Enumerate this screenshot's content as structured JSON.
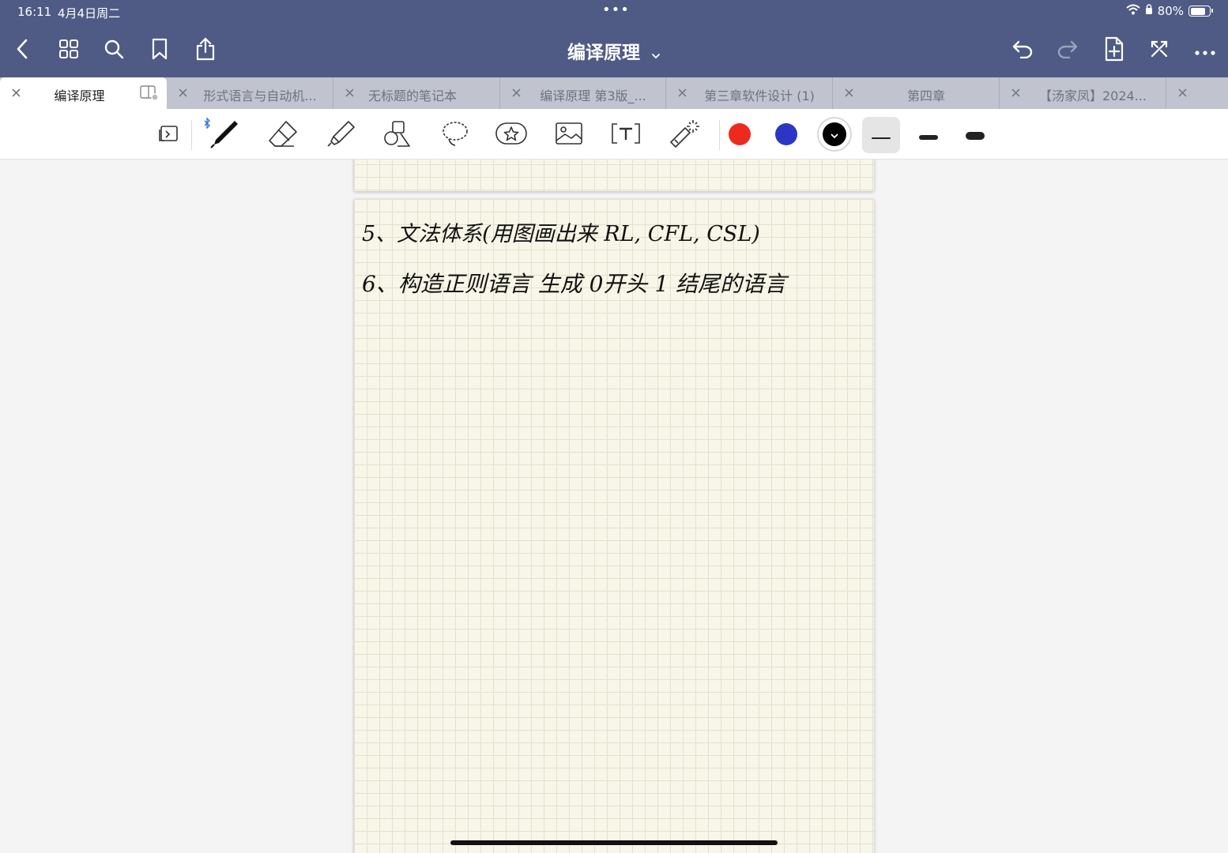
{
  "status_bar": {
    "time": "16:11",
    "date": "4月4日周二",
    "dots": "•••",
    "battery_text": "80%",
    "battery_level": 0.8
  },
  "nav": {
    "title": "编译原理",
    "left_icons": [
      "back-icon",
      "grid-icon",
      "search-icon",
      "bookmark-icon",
      "share-icon"
    ],
    "right_icons": [
      "undo-icon",
      "redo-icon",
      "add-page-icon",
      "close-fullscreen-icon",
      "more-icon"
    ]
  },
  "tabs": [
    {
      "label": "编译原理",
      "active": true
    },
    {
      "label": "形式语言与自动机...",
      "active": false
    },
    {
      "label": "无标题的笔记本",
      "active": false
    },
    {
      "label": "编译原理  第3版_...",
      "active": false
    },
    {
      "label": "第三章软件设计 (1)",
      "active": false
    },
    {
      "label": "第四章",
      "active": false
    },
    {
      "label": "【汤家凤】2024...",
      "active": false
    },
    {
      "label": "",
      "active": false
    }
  ],
  "toolbar": {
    "tools": [
      "sidebar-toggle-icon",
      "pen-icon",
      "eraser-icon",
      "highlighter-icon",
      "shapes-icon",
      "lasso-icon",
      "sticker-icon",
      "image-icon",
      "text-icon",
      "laser-pointer-icon"
    ],
    "colors": [
      "#ee2a1e",
      "#2b37c4",
      "#000000"
    ],
    "thickness_levels": 3,
    "selected_thickness": 1
  },
  "note": {
    "line1": "5、文法体系(用图画出来  RL, CFL, CSL)",
    "line2": "6、构造正则语言   生成 0开头  1 结尾的语言"
  }
}
